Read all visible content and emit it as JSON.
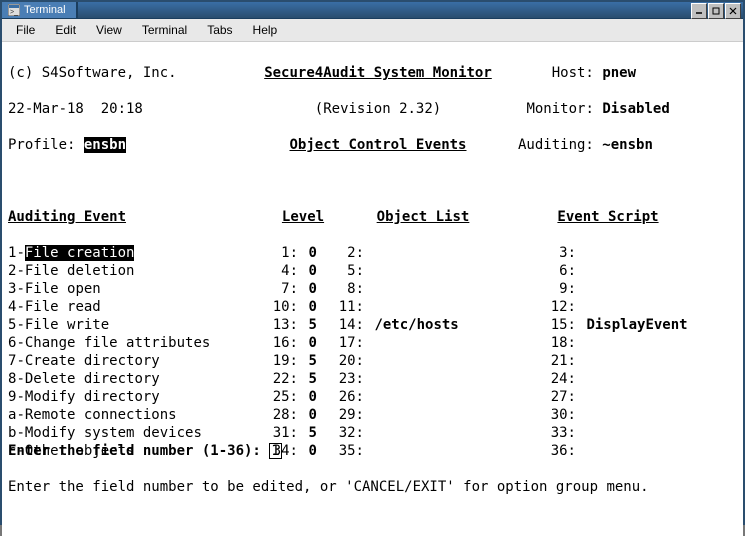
{
  "window": {
    "title": "Terminal"
  },
  "menu": {
    "file": "File",
    "edit": "Edit",
    "view": "View",
    "terminal": "Terminal",
    "tabs": "Tabs",
    "help": "Help"
  },
  "top": {
    "copyright": "(c) S4Software, Inc.",
    "app_title": "Secure4Audit System Monitor",
    "host_label": "Host:",
    "host_value": "pnew",
    "date": "22-Mar-18  20:18",
    "revision": "(Revision 2.32)",
    "monitor_label": "Monitor:",
    "monitor_value": "Disabled",
    "profile_label": "Profile:",
    "profile_value": "ensbn",
    "section_title": "Object Control Events",
    "auditing_label": "Auditing:",
    "auditing_value": "~ensbn"
  },
  "headers": {
    "event": "Auditing Event",
    "level": "Level",
    "object_list": "Object List",
    "event_script": "Event Script"
  },
  "rows": [
    {
      "key": "1",
      "name": "File creation",
      "n1": "1",
      "lvl": "0",
      "n2": "2",
      "obj": "",
      "n3": "3",
      "script": "",
      "sel": true
    },
    {
      "key": "2",
      "name": "File deletion",
      "n1": "4",
      "lvl": "0",
      "n2": "5",
      "obj": "",
      "n3": "6",
      "script": ""
    },
    {
      "key": "3",
      "name": "File open",
      "n1": "7",
      "lvl": "0",
      "n2": "8",
      "obj": "",
      "n3": "9",
      "script": ""
    },
    {
      "key": "4",
      "name": "File read",
      "n1": "10",
      "lvl": "0",
      "n2": "11",
      "obj": "",
      "n3": "12",
      "script": ""
    },
    {
      "key": "5",
      "name": "File write",
      "n1": "13",
      "lvl": "5",
      "n2": "14",
      "obj": "/etc/hosts",
      "n3": "15",
      "script": "DisplayEvent"
    },
    {
      "key": "6",
      "name": "Change file attributes",
      "n1": "16",
      "lvl": "0",
      "n2": "17",
      "obj": "",
      "n3": "18",
      "script": ""
    },
    {
      "key": "7",
      "name": "Create directory",
      "n1": "19",
      "lvl": "5",
      "n2": "20",
      "obj": "",
      "n3": "21",
      "script": ""
    },
    {
      "key": "8",
      "name": "Delete directory",
      "n1": "22",
      "lvl": "5",
      "n2": "23",
      "obj": "",
      "n3": "24",
      "script": ""
    },
    {
      "key": "9",
      "name": "Modify directory",
      "n1": "25",
      "lvl": "0",
      "n2": "26",
      "obj": "",
      "n3": "27",
      "script": ""
    },
    {
      "key": "a",
      "name": "Remote connections",
      "n1": "28",
      "lvl": "0",
      "n2": "29",
      "obj": "",
      "n3": "30",
      "script": ""
    },
    {
      "key": "b",
      "name": "Modify system devices",
      "n1": "31",
      "lvl": "5",
      "n2": "32",
      "obj": "",
      "n3": "33",
      "script": ""
    },
    {
      "key": "c",
      "name": "Other objects",
      "n1": "34",
      "lvl": "0",
      "n2": "35",
      "obj": "",
      "n3": "36",
      "script": ""
    }
  ],
  "prompt": {
    "line1_prefix": "Enter the field number (1-36): ",
    "input_value": "1",
    "line2": "Enter the field number to be edited, or 'CANCEL/EXIT' for option group menu."
  }
}
